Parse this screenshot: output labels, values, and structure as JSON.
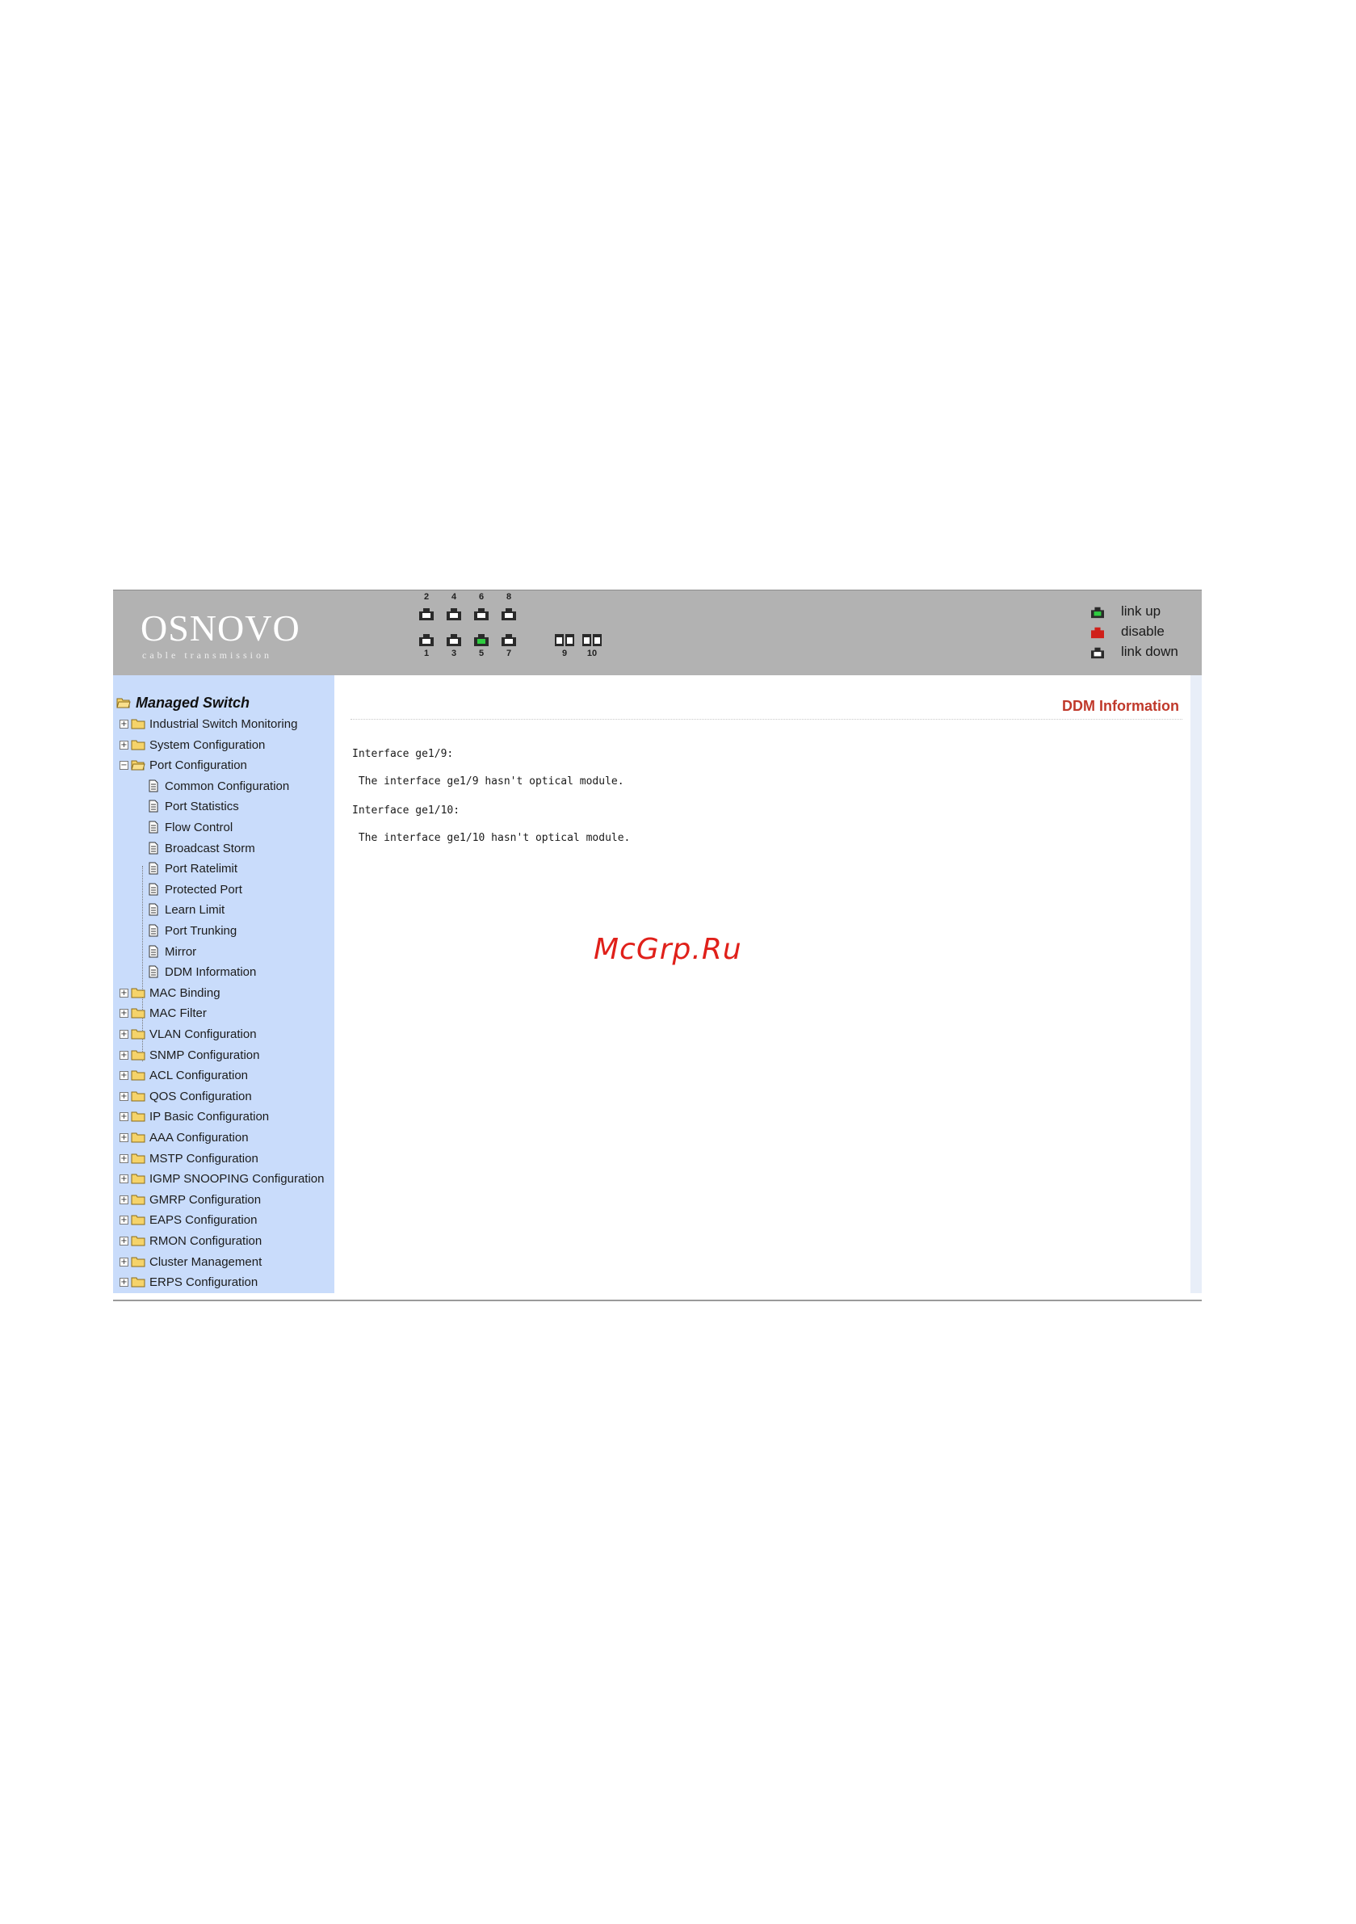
{
  "header": {
    "logo_name": "OSNOVO",
    "logo_tagline": "cable transmission",
    "ports_top": [
      {
        "label": "2",
        "status": "link down"
      },
      {
        "label": "4",
        "status": "link down"
      },
      {
        "label": "6",
        "status": "link down"
      },
      {
        "label": "8",
        "status": "link down"
      }
    ],
    "ports_bottom": [
      {
        "label": "1",
        "status": "link down"
      },
      {
        "label": "3",
        "status": "link down"
      },
      {
        "label": "5",
        "status": "link up"
      },
      {
        "label": "7",
        "status": "link down"
      }
    ],
    "sfp_ports": [
      {
        "label": "9",
        "status": "link down"
      },
      {
        "label": "10",
        "status": "link down"
      }
    ],
    "legend": [
      {
        "label": "link up",
        "color": "#2ecc40"
      },
      {
        "label": "disable",
        "color": "#d0201a"
      },
      {
        "label": "link down",
        "color": "#2a2a2a"
      }
    ]
  },
  "sidebar": {
    "root": "Managed Switch",
    "items": [
      {
        "label": "Industrial Switch Monitoring",
        "type": "folder",
        "expanded": false
      },
      {
        "label": "System Configuration",
        "type": "folder",
        "expanded": false
      },
      {
        "label": "Port Configuration",
        "type": "folder",
        "expanded": true
      },
      {
        "label": "Common Configuration",
        "type": "page"
      },
      {
        "label": "Port Statistics",
        "type": "page"
      },
      {
        "label": "Flow Control",
        "type": "page"
      },
      {
        "label": "Broadcast Storm",
        "type": "page"
      },
      {
        "label": "Port Ratelimit",
        "type": "page"
      },
      {
        "label": "Protected Port",
        "type": "page"
      },
      {
        "label": "Learn Limit",
        "type": "page"
      },
      {
        "label": "Port Trunking",
        "type": "page"
      },
      {
        "label": "Mirror",
        "type": "page"
      },
      {
        "label": "DDM Information",
        "type": "page"
      },
      {
        "label": "MAC Binding",
        "type": "folder",
        "expanded": false
      },
      {
        "label": "MAC Filter",
        "type": "folder",
        "expanded": false
      },
      {
        "label": "VLAN Configuration",
        "type": "folder",
        "expanded": false
      },
      {
        "label": "SNMP Configuration",
        "type": "folder",
        "expanded": false
      },
      {
        "label": "ACL Configuration",
        "type": "folder",
        "expanded": false
      },
      {
        "label": "QOS Configuration",
        "type": "folder",
        "expanded": false
      },
      {
        "label": "IP Basic Configuration",
        "type": "folder",
        "expanded": false
      },
      {
        "label": "AAA Configuration",
        "type": "folder",
        "expanded": false
      },
      {
        "label": "MSTP Configuration",
        "type": "folder",
        "expanded": false
      },
      {
        "label": "IGMP SNOOPING Configuration",
        "type": "folder",
        "expanded": false
      },
      {
        "label": "GMRP Configuration",
        "type": "folder",
        "expanded": false
      },
      {
        "label": "EAPS Configuration",
        "type": "folder",
        "expanded": false
      },
      {
        "label": "RMON Configuration",
        "type": "folder",
        "expanded": false
      },
      {
        "label": "Cluster Management",
        "type": "folder",
        "expanded": false
      },
      {
        "label": "ERPS Configuration",
        "type": "folder",
        "expanded": false
      }
    ]
  },
  "main": {
    "title": "DDM Information",
    "lines": [
      {
        "text": "Interface ge1/9:"
      },
      {
        "text": " The interface ge1/9 hasn't optical module."
      },
      {
        "text": "Interface ge1/10:"
      },
      {
        "text": " The interface ge1/10 hasn't optical module."
      }
    ]
  },
  "watermark": "McGrp.Ru"
}
